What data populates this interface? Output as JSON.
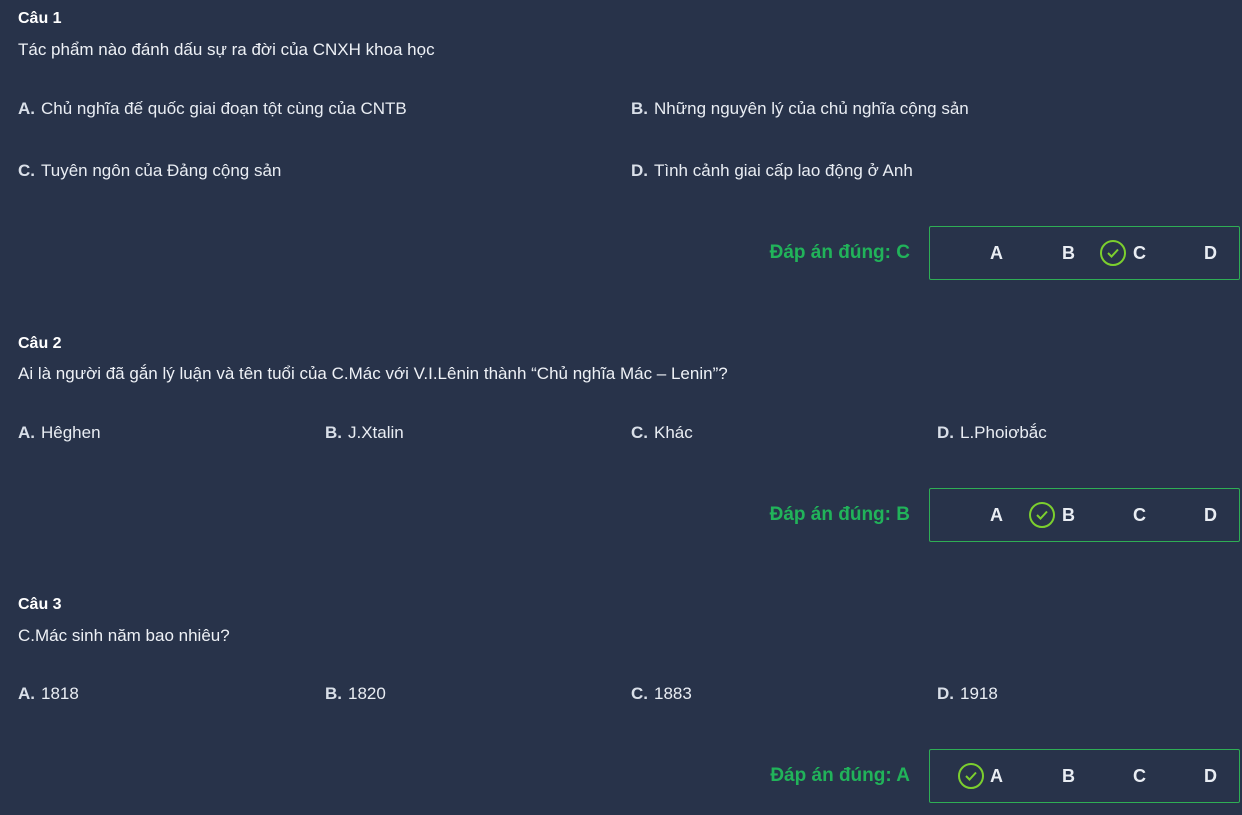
{
  "questions": [
    {
      "label": "Câu 1",
      "text": "Tác phẩm nào đánh dấu sự ra đời của CNXH khoa học",
      "options": [
        {
          "letter": "A.",
          "text": "Chủ nghĩa đế quốc giai đoạn tột cùng của CNTB"
        },
        {
          "letter": "B.",
          "text": "Những nguyên lý của chủ nghĩa cộng sản"
        },
        {
          "letter": "C.",
          "text": "Tuyên ngôn của Đảng cộng sản"
        },
        {
          "letter": "D.",
          "text": "Tình cảnh giai cấp lao động ở Anh"
        }
      ],
      "answer_text": "Đáp án đúng: C",
      "choices": [
        "A",
        "B",
        "C",
        "D"
      ],
      "correct": "C"
    },
    {
      "label": "Câu 2",
      "text": "Ai là người đã gắn lý luận và tên tuổi của C.Mác với V.I.Lênin thành “Chủ nghĩa Mác – Lenin”?",
      "options": [
        {
          "letter": "A.",
          "text": "Hêghen"
        },
        {
          "letter": "B.",
          "text": "J.Xtalin"
        },
        {
          "letter": "C.",
          "text": "Khác"
        },
        {
          "letter": "D.",
          "text": "L.Phoiơbắc"
        }
      ],
      "answer_text": "Đáp án đúng: B",
      "choices": [
        "A",
        "B",
        "C",
        "D"
      ],
      "correct": "B"
    },
    {
      "label": "Câu 3",
      "text": "C.Mác sinh năm bao nhiêu?",
      "options": [
        {
          "letter": "A.",
          "text": "1818"
        },
        {
          "letter": "B.",
          "text": "1820"
        },
        {
          "letter": "C.",
          "text": "1883"
        },
        {
          "letter": "D.",
          "text": "1918"
        }
      ],
      "answer_text": "Đáp án đúng: A",
      "choices": [
        "A",
        "B",
        "C",
        "D"
      ],
      "correct": "A"
    }
  ],
  "icons": {
    "check": "check-circle-icon"
  },
  "colors": {
    "background": "#28334a",
    "correct_text": "#21b35a",
    "check": "#7ccf2e"
  }
}
